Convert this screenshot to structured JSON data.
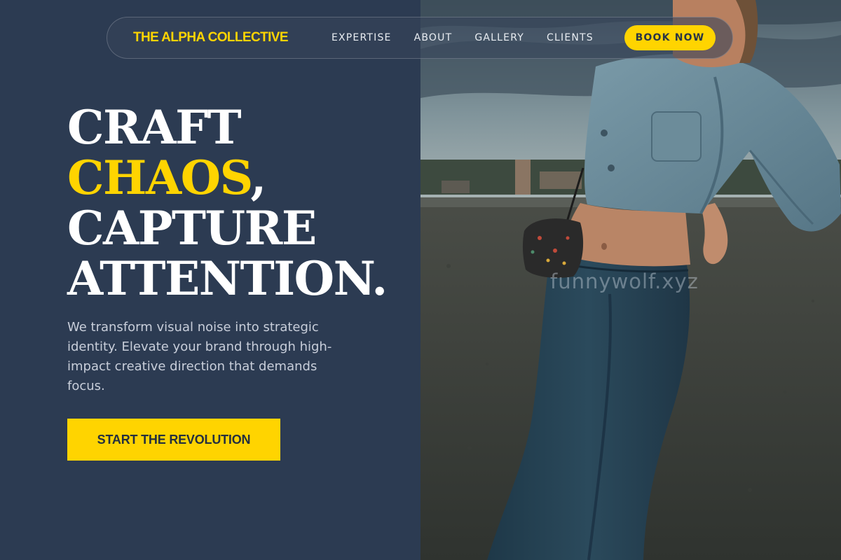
{
  "nav": {
    "brand": "THE ALPHA COLLECTIVE",
    "links": [
      "EXPERTISE",
      "ABOUT",
      "GALLERY",
      "CLIENTS"
    ],
    "cta_label": "BOOK NOW"
  },
  "hero": {
    "headline": {
      "line1": "CRAFT",
      "accent_word": "CHAOS",
      "accent_trailing": ",",
      "line3": "CAPTURE",
      "line4": "ATTENTION."
    },
    "description": "We transform visual noise into strategic identity. Elevate your brand through high-impact creative direction that demands focus.",
    "cta_label": "START THE REVOLUTION"
  },
  "image": {
    "watermark": "funnywolf.xyz"
  },
  "colors": {
    "background": "#2c3b52",
    "accent": "#ffd400",
    "heading": "#ffffff",
    "body_text": "#c8ceda"
  }
}
